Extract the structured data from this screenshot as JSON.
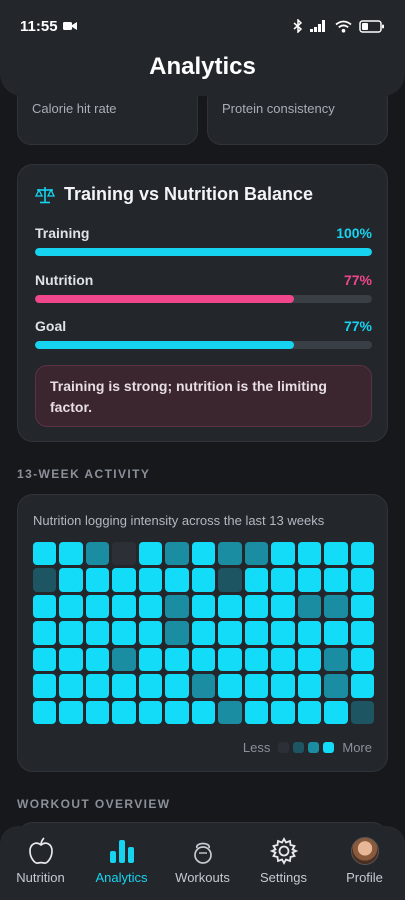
{
  "status": {
    "time": "11:55"
  },
  "header": {
    "title": "Analytics"
  },
  "metric_cards": [
    {
      "label": "Calorie hit rate"
    },
    {
      "label": "Protein consistency"
    }
  ],
  "balance": {
    "title": "Training vs Nutrition Balance",
    "bars": [
      {
        "label": "Training",
        "value_text": "100%",
        "value": 1.0,
        "color": "#16d4f0"
      },
      {
        "label": "Nutrition",
        "value_text": "77%",
        "value": 0.77,
        "color": "#f0468c"
      },
      {
        "label": "Goal",
        "value_text": "77%",
        "value": 0.77,
        "color": "#16d4f0"
      }
    ],
    "insight": "Training is strong; nutrition is the limiting factor."
  },
  "activity": {
    "section_label": "13-WEEK ACTIVITY",
    "subtitle": "Nutrition logging intensity across the last 13 weeks",
    "levels_palette": [
      "#2c3036",
      "#1d5563",
      "#1a8da3",
      "#12dcf8"
    ],
    "grid_levels": [
      [
        3,
        3,
        2,
        0,
        3,
        2,
        3,
        2,
        2,
        3,
        3,
        3,
        3
      ],
      [
        1,
        3,
        3,
        3,
        3,
        3,
        3,
        1,
        3,
        3,
        3,
        3,
        3
      ],
      [
        3,
        3,
        3,
        3,
        3,
        2,
        3,
        3,
        3,
        3,
        2,
        2,
        3
      ],
      [
        3,
        3,
        3,
        3,
        3,
        2,
        3,
        3,
        3,
        3,
        3,
        3,
        3
      ],
      [
        3,
        3,
        3,
        2,
        3,
        3,
        3,
        3,
        3,
        3,
        3,
        2,
        3
      ],
      [
        3,
        3,
        3,
        3,
        3,
        3,
        2,
        3,
        3,
        3,
        3,
        2,
        3
      ],
      [
        3,
        3,
        3,
        3,
        3,
        3,
        3,
        2,
        3,
        3,
        3,
        3,
        1
      ]
    ],
    "legend": {
      "less": "Less",
      "more": "More"
    }
  },
  "workout": {
    "section_label": "WORKOUT OVERVIEW"
  },
  "nav": {
    "items": [
      {
        "label": "Nutrition",
        "icon": "apple-icon"
      },
      {
        "label": "Analytics",
        "icon": "bar-chart-icon"
      },
      {
        "label": "Workouts",
        "icon": "kettlebell-icon"
      },
      {
        "label": "Settings",
        "icon": "gear-icon"
      },
      {
        "label": "Profile",
        "icon": "avatar"
      }
    ],
    "active": "Analytics"
  }
}
